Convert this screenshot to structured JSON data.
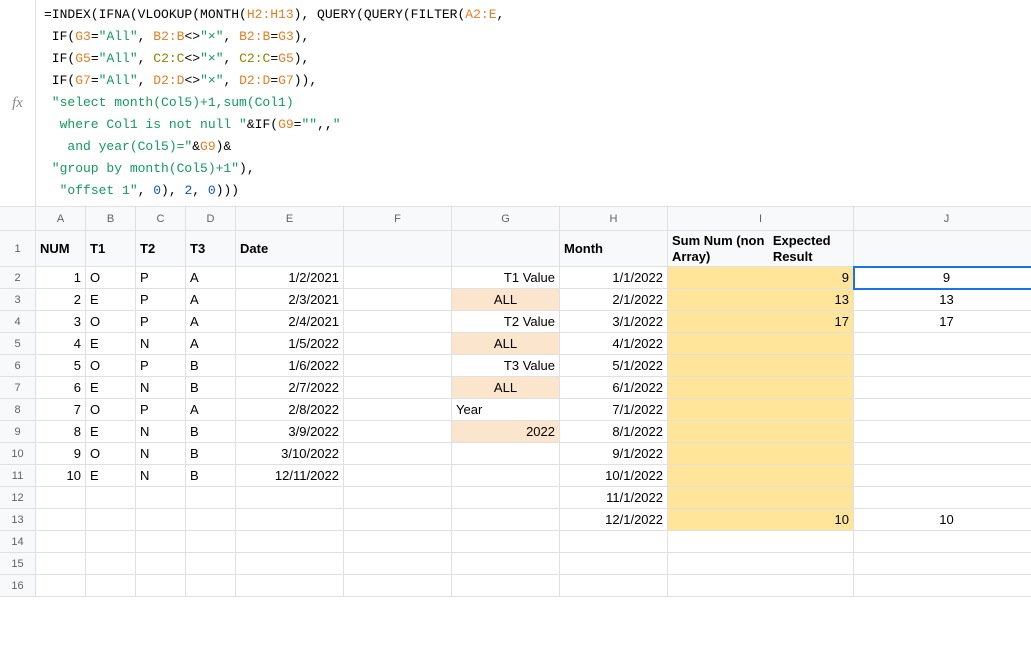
{
  "fx_label": "fx",
  "formula": {
    "l1": "=INDEX(IFNA(VLOOKUP(MONTH(",
    "l1_ref": "H2:H13",
    "l1b": "), QUERY(QUERY(FILTER(",
    "l1_ref2": "A2:E",
    "l1c": ",",
    "l2a": " IF(",
    "l2_ref": "G3",
    "l2b": "=",
    "l2_str": "\"All\"",
    "l2c": ", ",
    "l2_ref2": "B2:B",
    "l2d": "<>",
    "l2_str2": "\"×\"",
    "l2e": ", ",
    "l2_ref3": "B2:B",
    "l2f": "=",
    "l2_ref4": "G3",
    "l2g": "),",
    "l3a": " IF(",
    "l3_ref": "G5",
    "l3b": "=",
    "l3_str": "\"All\"",
    "l3c": ", ",
    "l3_ref2": "C2:C",
    "l3d": "<>",
    "l3_str2": "\"×\"",
    "l3e": ", ",
    "l3_ref3": "C2:C",
    "l3f": "=",
    "l3_ref4": "G5",
    "l3g": "),",
    "l4a": " IF(",
    "l4_ref": "G7",
    "l4b": "=",
    "l4_str": "\"All\"",
    "l4c": ", ",
    "l4_ref2": "D2:D",
    "l4d": "<>",
    "l4_str2": "\"×\"",
    "l4e": ", ",
    "l4_ref3": "D2:D",
    "l4f": "=",
    "l4_ref4": "G7",
    "l4g": ")),",
    "l5": " \"select month(Col5)+1,sum(Col1)",
    "l6a": "  where Col1 is not null \"",
    "l6b": "&IF(",
    "l6_ref": "G9",
    "l6c": "=",
    "l6_str": "\"\"",
    "l6d": ",,",
    "l6e": "\"",
    "l7a": "   and year(Col5)=\"",
    "l7b": "&",
    "l7_ref": "G9",
    "l7c": ")&",
    "l8": " \"group by month(Col5)+1\"",
    "l8b": "),",
    "l9a": "  ",
    "l9_str": "\"offset 1\"",
    "l9b": ", ",
    "l9_n1": "0",
    "l9c": "), ",
    "l9_n2": "2",
    "l9d": ", ",
    "l9_n3": "0",
    "l9e": ")))"
  },
  "columns": [
    "A",
    "B",
    "C",
    "D",
    "E",
    "F",
    "G",
    "H",
    "I",
    "J"
  ],
  "headers": {
    "A": "NUM",
    "B": "T1",
    "C": "T2",
    "D": "T3",
    "E": "Date",
    "H": "Month",
    "I_line1": "Sum Num (non Array)",
    "I_line2": "Expected Result"
  },
  "row_labels": [
    "1",
    "2",
    "3",
    "4",
    "5",
    "6",
    "7",
    "8",
    "9",
    "10",
    "11",
    "12",
    "13",
    "14",
    "15",
    "16"
  ],
  "labels": {
    "t1value": "T1 Value",
    "t2value": "T2 Value",
    "t3value": "T3 Value",
    "year": "Year",
    "all": "ALL",
    "yearval": "2022"
  },
  "tableA": [
    {
      "num": "1",
      "t1": "O",
      "t2": "P",
      "t3": "A",
      "date": "1/2/2021"
    },
    {
      "num": "2",
      "t1": "E",
      "t2": "P",
      "t3": "A",
      "date": "2/3/2021"
    },
    {
      "num": "3",
      "t1": "O",
      "t2": "P",
      "t3": "A",
      "date": "2/4/2021"
    },
    {
      "num": "4",
      "t1": "E",
      "t2": "N",
      "t3": "A",
      "date": "1/5/2022"
    },
    {
      "num": "5",
      "t1": "O",
      "t2": "P",
      "t3": "B",
      "date": "1/6/2022"
    },
    {
      "num": "6",
      "t1": "E",
      "t2": "N",
      "t3": "B",
      "date": "2/7/2022"
    },
    {
      "num": "7",
      "t1": "O",
      "t2": "P",
      "t3": "A",
      "date": "2/8/2022"
    },
    {
      "num": "8",
      "t1": "E",
      "t2": "N",
      "t3": "B",
      "date": "3/9/2022"
    },
    {
      "num": "9",
      "t1": "O",
      "t2": "N",
      "t3": "B",
      "date": "3/10/2022"
    },
    {
      "num": "10",
      "t1": "E",
      "t2": "N",
      "t3": "B",
      "date": "12/11/2022"
    }
  ],
  "months": [
    "1/1/2022",
    "2/1/2022",
    "3/1/2022",
    "4/1/2022",
    "5/1/2022",
    "6/1/2022",
    "7/1/2022",
    "8/1/2022",
    "9/1/2022",
    "10/1/2022",
    "11/1/2022",
    "12/1/2022"
  ],
  "sumI": [
    "9",
    "13",
    "17",
    "",
    "",
    "",
    "",
    "",
    "",
    "",
    "",
    "10"
  ],
  "sumJ": [
    "9",
    "13",
    "17",
    "",
    "",
    "",
    "",
    "",
    "",
    "",
    "",
    "10"
  ]
}
